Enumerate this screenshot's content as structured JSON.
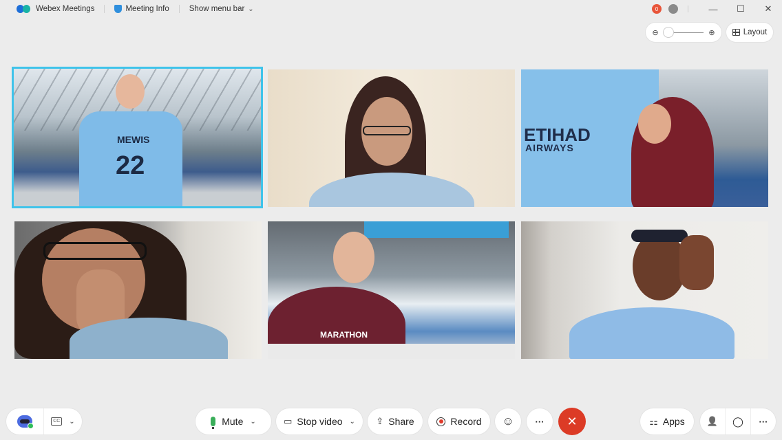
{
  "titlebar": {
    "app_name": "Webex Meetings",
    "meeting_info": "Meeting Info",
    "show_menu_bar": "Show menu bar",
    "chevron": "⌄",
    "notification_badge": "0",
    "minimize": "—",
    "maximize": "☐",
    "close": "✕"
  },
  "view_controls": {
    "zoom_out_icon": "⊖",
    "zoom_in_icon": "⊕",
    "zoom_level_fraction": 0.0,
    "layout_label": "Layout"
  },
  "participants": [
    {
      "active_speaker": true,
      "scene": "stadium",
      "shirt_text": "MEWIS 22"
    },
    {
      "active_speaker": false,
      "scene": "home-light"
    },
    {
      "active_speaker": false,
      "scene": "stadium",
      "shirt_text": "ETIHAD AIRWAYS"
    },
    {
      "active_speaker": false,
      "scene": "home-room"
    },
    {
      "active_speaker": false,
      "scene": "stadium",
      "shirt_text": "MARATHON"
    },
    {
      "active_speaker": false,
      "scene": "home-wall"
    }
  ],
  "toolbar": {
    "cc_label": "CC",
    "caret": "⌄",
    "mute_label": "Mute",
    "stop_video_label": "Stop video",
    "share_label": "Share",
    "record_label": "Record",
    "reactions_icon": "☺",
    "more_icon": "···",
    "end_icon": "✕",
    "apps_label": "Apps",
    "participants_icon": "👤",
    "chat_icon": "💬",
    "more_right_icon": "···"
  },
  "colors": {
    "active_speaker_border": "#3fc3ea",
    "end_call": "#dc3b26",
    "mic_active": "#3aae5a",
    "badge_red": "#e8553a"
  }
}
